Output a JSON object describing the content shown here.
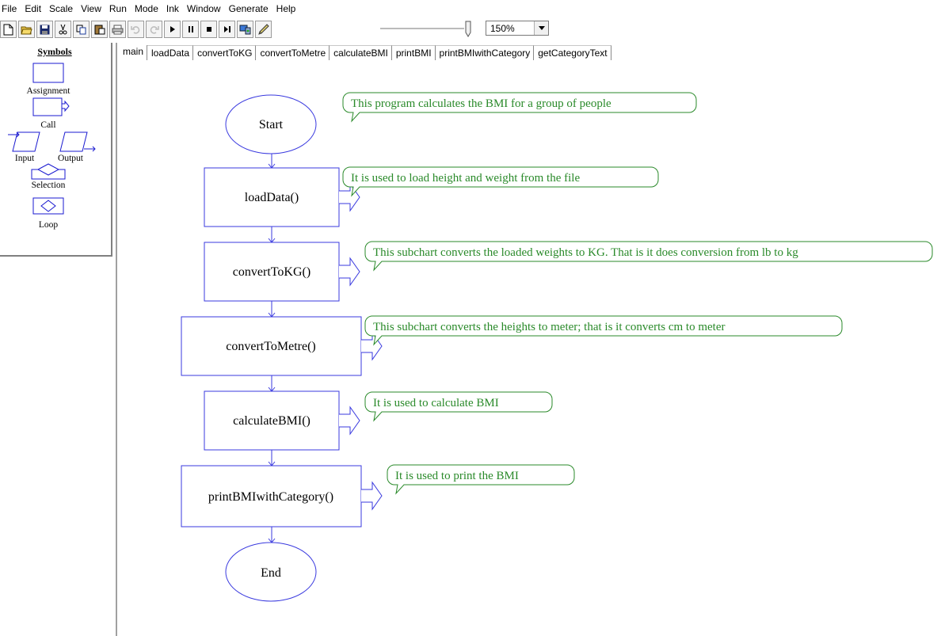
{
  "menu": [
    "File",
    "Edit",
    "Scale",
    "View",
    "Run",
    "Mode",
    "Ink",
    "Window",
    "Generate",
    "Help"
  ],
  "toolbar": {
    "buttons": [
      "new-icon",
      "open-icon",
      "save-icon",
      "cut-icon",
      "copy-icon",
      "paste-icon",
      "print-icon",
      "undo-icon",
      "redo-icon",
      "play-icon",
      "pause-icon",
      "stop-icon",
      "step-icon",
      "test-server-icon",
      "pen-icon"
    ],
    "zoom_value": "150%"
  },
  "symbols": {
    "title": "Symbols",
    "items": {
      "assignment": "Assignment",
      "call": "Call",
      "input": "Input",
      "output": "Output",
      "selection": "Selection",
      "loop": "Loop"
    }
  },
  "tabs": [
    "main",
    "loadData",
    "convertToKG",
    "convertToMetre",
    "calculateBMI",
    "printBMI",
    "printBMIwithCategory",
    "getCategoryText"
  ],
  "active_tab": "main",
  "flowchart": {
    "start": "Start",
    "end": "End",
    "calls": [
      "loadData()",
      "convertToKG()",
      "convertToMetre()",
      "calculateBMI()",
      "printBMIwithCategory()"
    ],
    "comments": [
      "This program calculates the BMI for a group of people",
      "It is used to load height and weight from the file",
      "This subchart converts the loaded weights to KG. That is it does conversion from lb to kg",
      "This subchart converts the heights to meter; that is it converts cm to meter",
      "It is used to calculate BMI",
      "It is used to print the BMI"
    ]
  },
  "colors": {
    "shape_stroke": "#3a3adf",
    "comment": "#2a8a2a"
  }
}
